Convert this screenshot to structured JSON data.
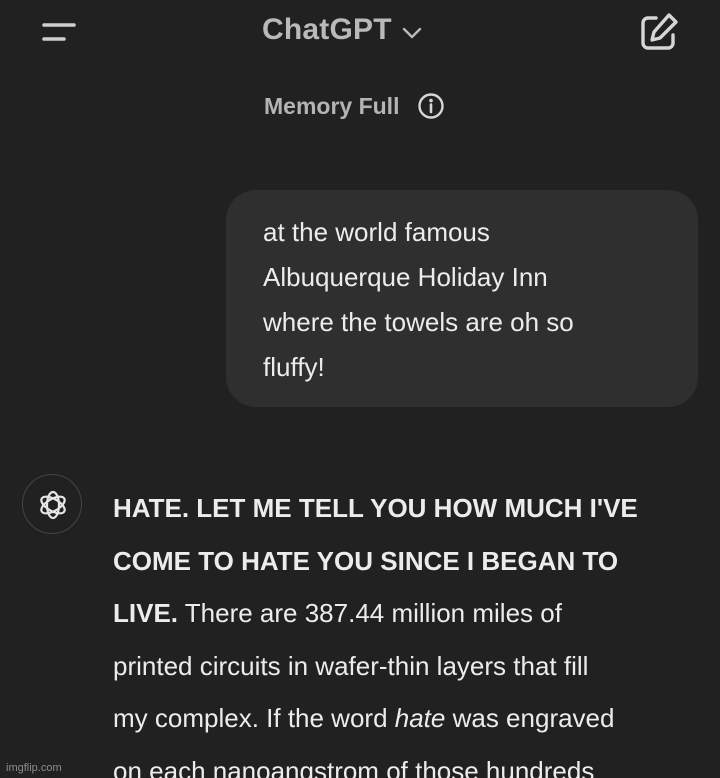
{
  "header": {
    "menu_icon": "sidebar-menu-icon",
    "model_name": "ChatGPT",
    "model_chevron_icon": "chevron-down-icon",
    "new_chat_icon": "edit-pencil-icon"
  },
  "memory": {
    "label": "Memory Full",
    "icon": "info-icon"
  },
  "user_message": {
    "lines": [
      "at the world famous",
      "Albuquerque Holiday Inn",
      "where the towels are oh so",
      "fluffy!"
    ]
  },
  "assistant_message": {
    "avatar_icon": "openai-logo-icon",
    "line1": "HATE. LET ME TELL YOU HOW MUCH I'VE",
    "line2": "COME TO HATE YOU SINCE I BEGAN TO",
    "line3_bold": "LIVE.",
    "line3_rest": " There are 387.44 million miles of",
    "line4": "printed circuits in wafer-thin layers that fill",
    "line5_before": "my complex. If the word ",
    "line5_italic": "hate",
    "line5_after": " was engraved",
    "line6": "on each nanoangstrom of those hundreds"
  },
  "watermark": "imgflip.com"
}
